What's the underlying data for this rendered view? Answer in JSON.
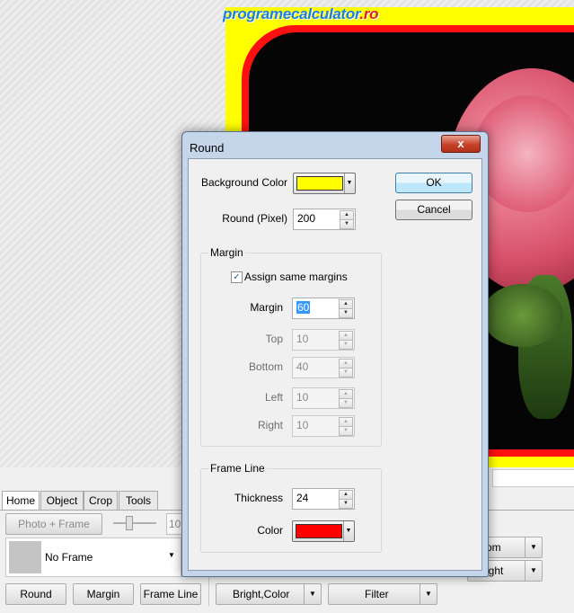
{
  "watermark": {
    "main": "programecalculator",
    "suffix": ".ro"
  },
  "tabs": [
    {
      "label": "Home"
    },
    {
      "label": "Object"
    },
    {
      "label": "Crop"
    },
    {
      "label": "Tools"
    }
  ],
  "toolbar": {
    "photo_frame_label": "Photo + Frame",
    "zoom_value": "10",
    "frame_select_value": "No Frame",
    "round_label": "Round",
    "margin_label": "Margin",
    "frame_line_label": "Frame Line",
    "bright_color_label": "Bright,Color",
    "filter_label": "Filter",
    "right_dropdown_1": "om",
    "right_dropdown_2": "ight"
  },
  "dialog": {
    "title": "Round",
    "close_label": "x",
    "ok_label": "OK",
    "cancel_label": "Cancel",
    "background_color_label": "Background Color",
    "background_color": "#ffff00",
    "round_label": "Round (Pixel)",
    "round_value": "200",
    "margin_group": {
      "title": "Margin",
      "assign_same_label": "Assign same margins",
      "assign_same_checked": true,
      "margin_label": "Margin",
      "margin_value": "60",
      "top_label": "Top",
      "top_value": "10",
      "bottom_label": "Bottom",
      "bottom_value": "40",
      "left_label": "Left",
      "left_value": "10",
      "right_label": "Right",
      "right_value": "10"
    },
    "frame_line_group": {
      "title": "Frame Line",
      "thickness_label": "Thickness",
      "thickness_value": "24",
      "color_label": "Color",
      "color": "#ff0000"
    }
  }
}
